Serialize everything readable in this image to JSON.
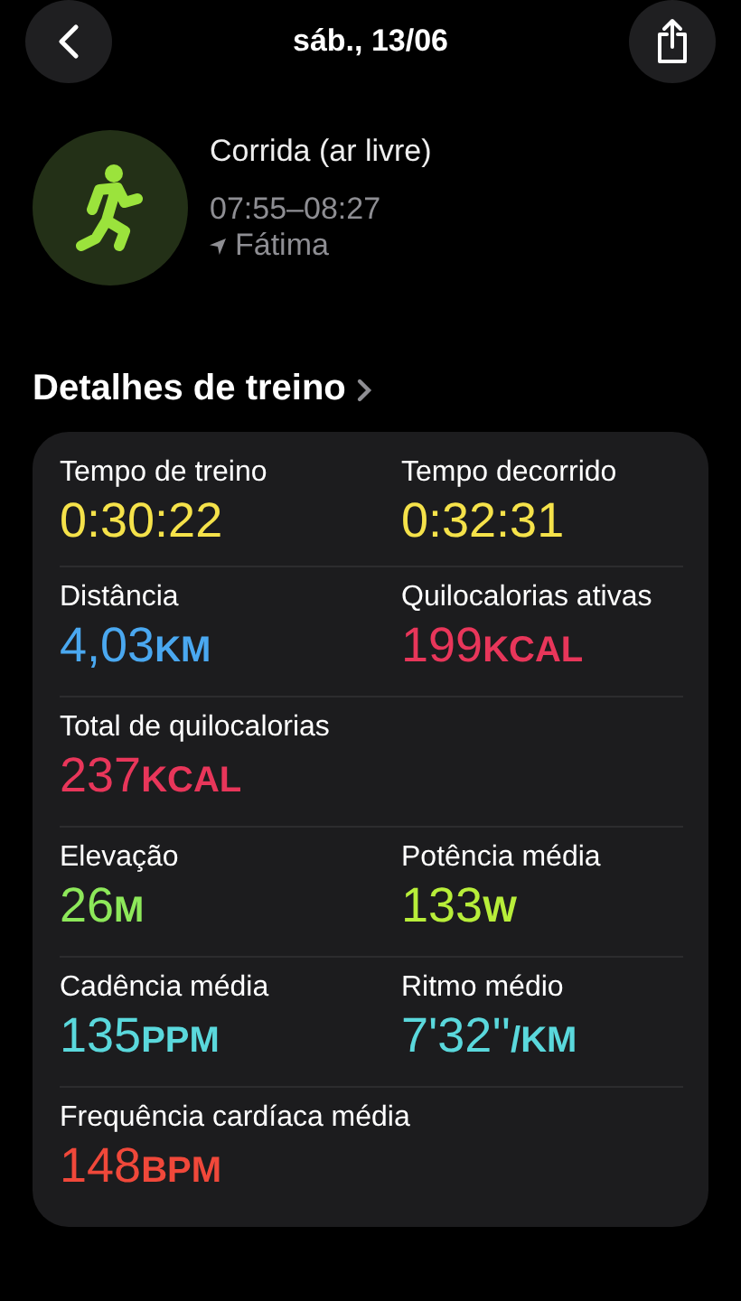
{
  "header": {
    "title": "sáb., 13/06"
  },
  "workout": {
    "name": "Corrida (ar livre)",
    "time": "07:55–08:27",
    "location": "Fátima"
  },
  "section": {
    "title": "Detalhes de treino"
  },
  "rows": [
    {
      "metrics": [
        {
          "label": "Tempo de treino",
          "value": "0:30:22",
          "color": "#f5e24a"
        },
        {
          "label": "Tempo decorrido",
          "value": "0:32:31",
          "color": "#f5e24a"
        }
      ]
    },
    {
      "metrics": [
        {
          "label": "Distância",
          "value": "4,03",
          "unit": "KM",
          "color": "#4aa8f0"
        },
        {
          "label": "Quilocalorias ativas",
          "value": "199",
          "unit": "KCAL",
          "color": "#e8365a"
        }
      ]
    },
    {
      "metrics": [
        {
          "label": "Total de quilocalorias",
          "value": "237",
          "unit": "KCAL",
          "color": "#e8365a"
        }
      ]
    },
    {
      "metrics": [
        {
          "label": "Elevação",
          "value": "26",
          "unit": "M",
          "color": "#8de85a"
        },
        {
          "label": "Potência média",
          "value": "133",
          "unit": "W",
          "color": "#b8ee3a"
        }
      ]
    },
    {
      "metrics": [
        {
          "label": "Cadência média",
          "value": "135",
          "unit": "PPM",
          "color": "#5ad8dc"
        },
        {
          "label": "Ritmo médio",
          "value": "7'32''",
          "unit": "/KM",
          "color": "#5ad8dc"
        }
      ]
    },
    {
      "metrics": [
        {
          "label": "Frequência cardíaca média",
          "value": "148",
          "unit": "BPM",
          "color": "#f0483a"
        }
      ]
    }
  ]
}
